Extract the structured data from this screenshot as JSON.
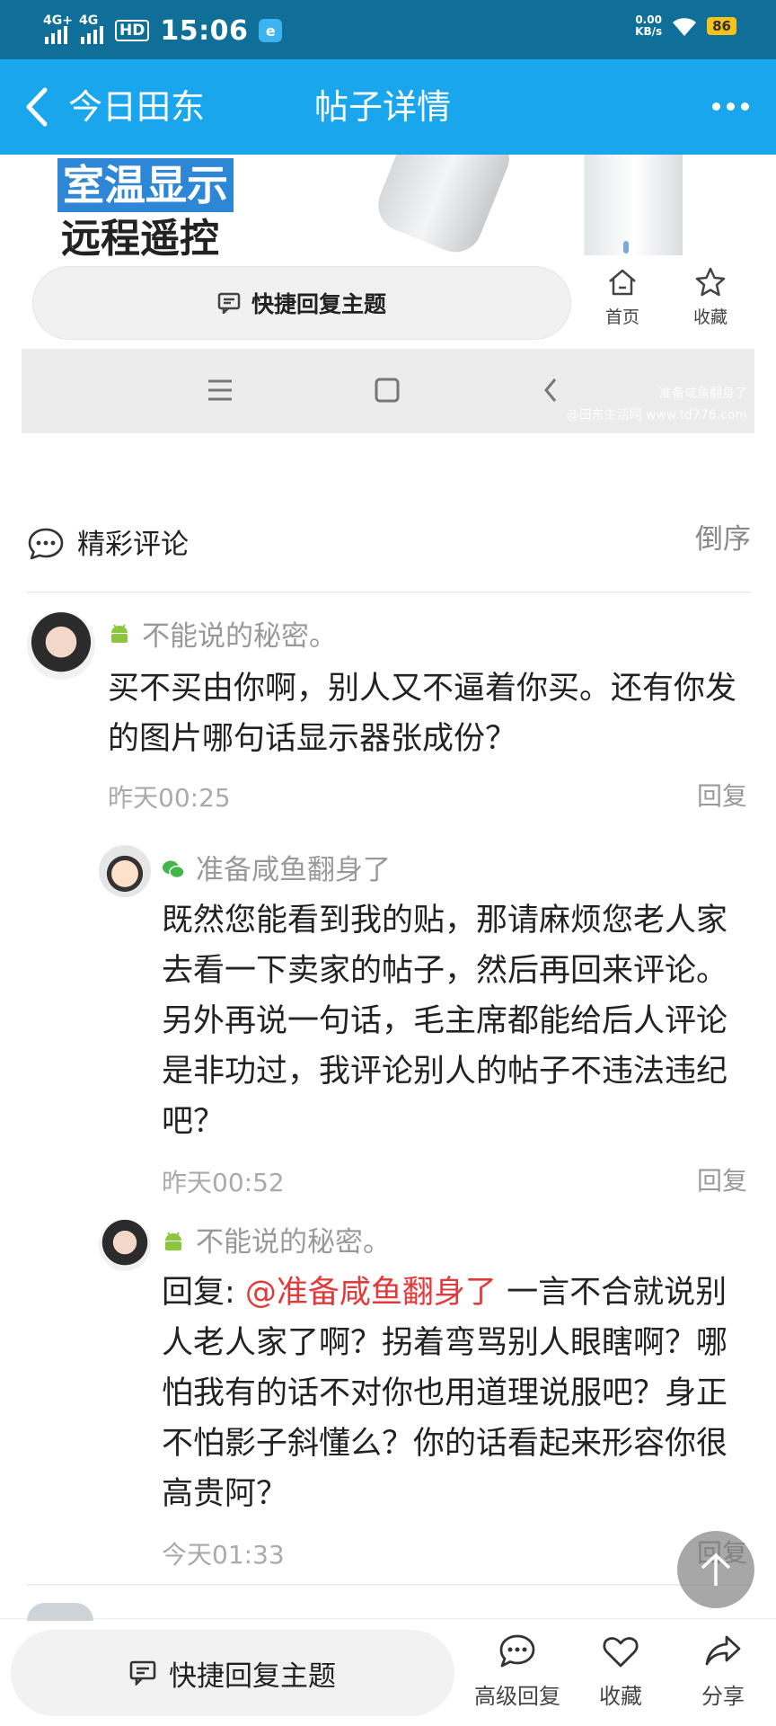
{
  "status_bar": {
    "signal_1": "4G+",
    "signal_2": "4G",
    "hd_badge": "HD",
    "time": "15:06",
    "app_badge": "e",
    "net_speed_value": "0.00",
    "net_speed_unit": "KB/s",
    "battery": "86"
  },
  "navbar": {
    "back_label": "今日田东",
    "title": "帖子详情"
  },
  "embedded_screenshot": {
    "promo_line_1": "室温显示",
    "promo_line_2": "远程遥控",
    "quick_reply_label": "快捷回复主题",
    "home_label": "首页",
    "favorite_label": "收藏",
    "watermark_line_1": "准备咸鱼翻身了",
    "watermark_line_2": "@田东生活网 www.td776.com"
  },
  "comments_header": {
    "title": "精彩评论",
    "order": "倒序"
  },
  "comments": [
    {
      "username": "不能说的秘密。",
      "text": "买不买由你啊，别人又不逼着你买。还有你发的图片哪句话显示器张成份？",
      "time": "昨天00:25",
      "reply": "回复"
    },
    {
      "username": "准备咸鱼翻身了",
      "text": "既然您能看到我的贴，那请麻烦您老人家去看一下卖家的帖子，然后再回来评论。另外再说一句话，毛主席都能给后人评论是非功过，我评论别人的帖子不违法违纪吧？",
      "time": "昨天00:52",
      "reply": "回复"
    },
    {
      "username": "不能说的秘密。",
      "reply_prefix": "回复: ",
      "mention": "@准备咸鱼翻身了",
      "text": " 一言不合就说别人老人家了啊？拐着弯骂别人眼瞎啊？哪怕我有的话不对你也用道理说服吧？身正不怕影子斜懂么？你的话看起来形容你很高贵阿？",
      "time": "今天01:33",
      "reply": "回复"
    }
  ],
  "bottom_bar": {
    "quick_reply": "快捷回复主题",
    "advanced_reply": "高级回复",
    "favorite": "收藏",
    "share": "分享"
  }
}
